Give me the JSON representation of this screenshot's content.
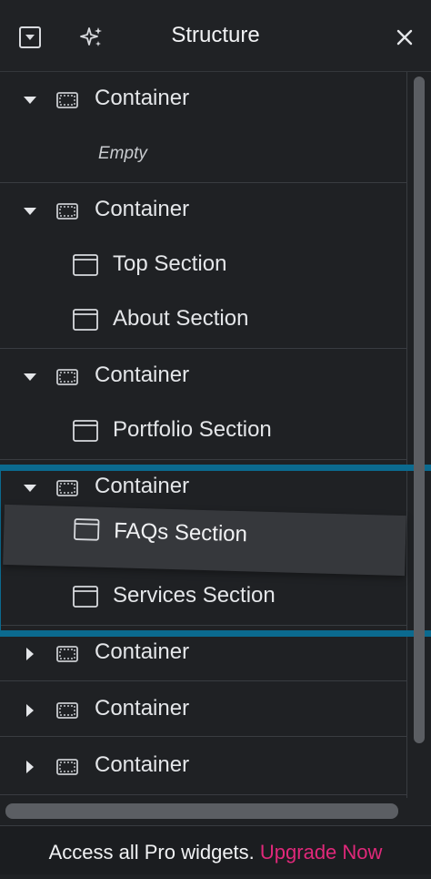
{
  "header": {
    "title": "Structure",
    "left_icons": [
      "panel-collapse-icon",
      "ai-sparkle-icon"
    ],
    "close_icon": "close-icon"
  },
  "tree": {
    "groups": [
      {
        "label": "Container",
        "expanded": true,
        "children": [],
        "empty_text": "Empty"
      },
      {
        "label": "Container",
        "expanded": true,
        "children": [
          "Top Section",
          "About Section"
        ]
      },
      {
        "label": "Container",
        "expanded": true,
        "children": [
          "Portfolio Section"
        ]
      },
      {
        "label": "Container",
        "expanded": true,
        "children": [
          "FAQs Section",
          "Services Section"
        ],
        "dragging_child": "FAQs Section"
      },
      {
        "label": "Container",
        "expanded": false,
        "children": []
      },
      {
        "label": "Container",
        "expanded": false,
        "children": []
      },
      {
        "label": "Container",
        "expanded": false,
        "children": []
      }
    ]
  },
  "footer": {
    "text": "Access all Pro widgets.",
    "link": "Upgrade Now"
  },
  "colors": {
    "background": "#1f2124",
    "highlight": "#0b6a8f",
    "link": "#e0287a"
  }
}
